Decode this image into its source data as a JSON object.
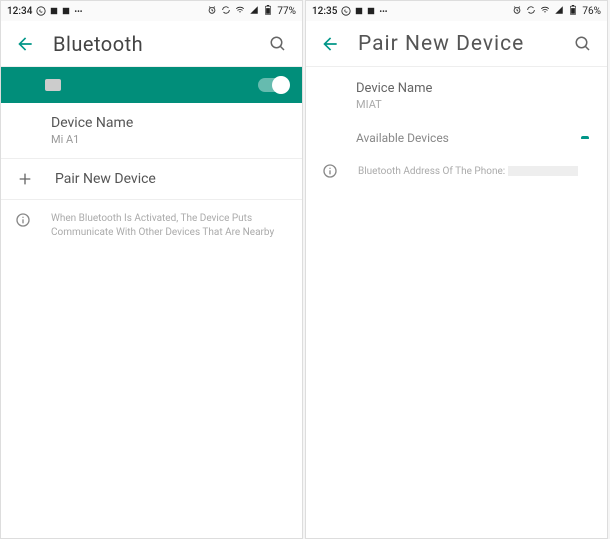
{
  "left": {
    "status": {
      "time": "12:34",
      "battery": "77%"
    },
    "appbar": {
      "title": "Bluetooth"
    },
    "device": {
      "label": "Device Name",
      "value": "Mi A1"
    },
    "pair": {
      "label": "Pair New Device"
    },
    "info": {
      "text": "When Bluetooth Is Activated, The Device Puts Communicate With Other Devices That Are Nearby"
    }
  },
  "right": {
    "status": {
      "time": "12:35",
      "battery": "76%"
    },
    "appbar": {
      "title": "Pair New Device"
    },
    "device": {
      "label": "Device Name",
      "value": "MIAT"
    },
    "available": {
      "label": "Available Devices"
    },
    "address": {
      "label": "Bluetooth Address Of The Phone:"
    }
  }
}
